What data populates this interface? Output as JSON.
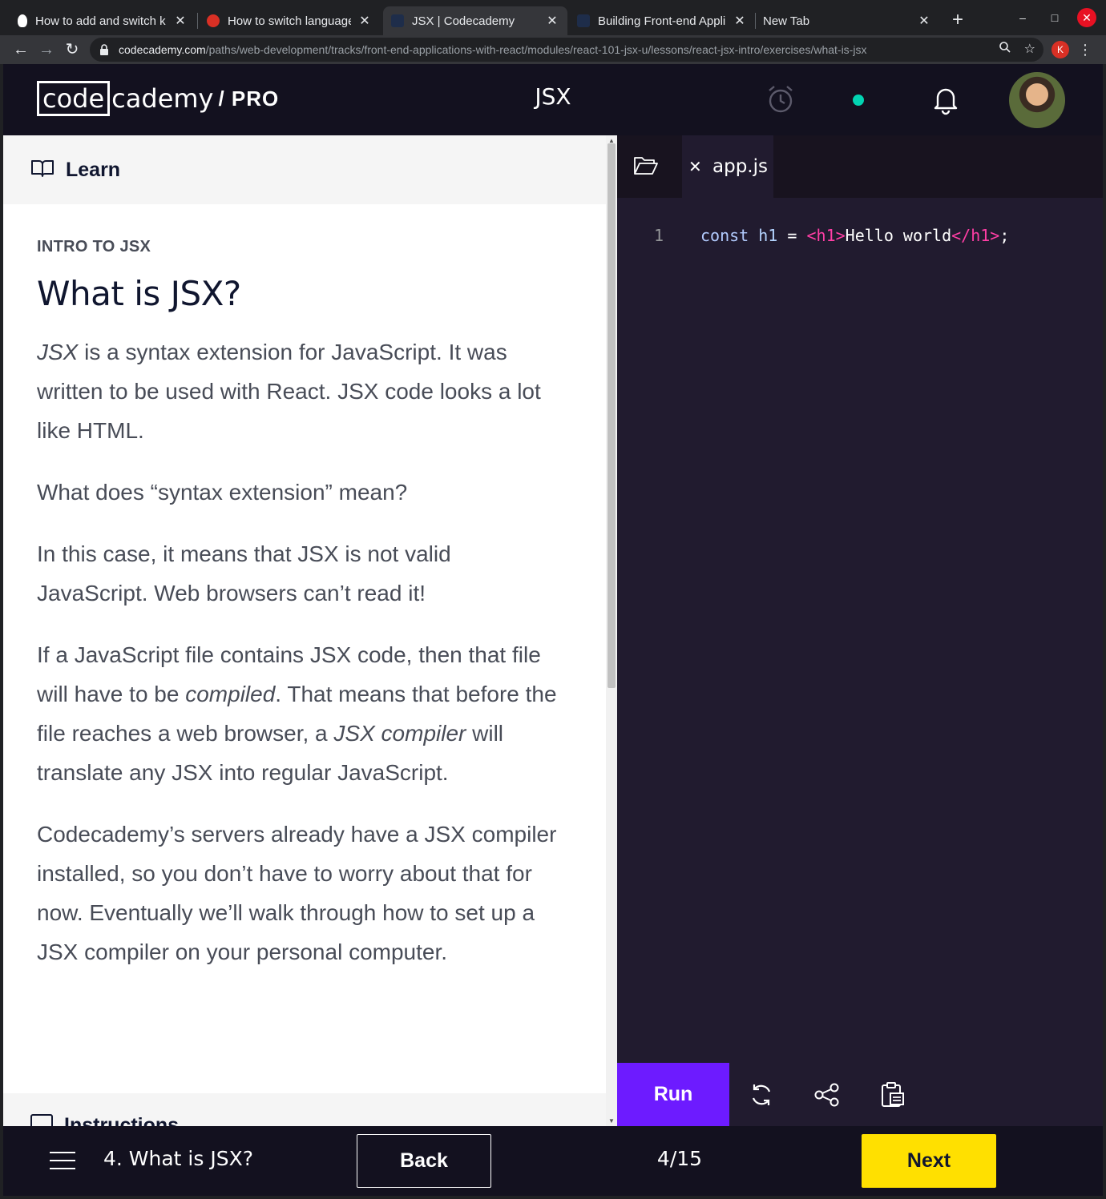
{
  "browser": {
    "tabs": [
      {
        "title": "How to add and switch k",
        "favicon_color": "#ffffff"
      },
      {
        "title": "How to switch language",
        "favicon_color": "#d93025"
      },
      {
        "title": "JSX | Codecademy",
        "favicon_color": "#1e2d4a"
      },
      {
        "title": "Building Front-end Appli",
        "favicon_color": "#1e2d4a"
      },
      {
        "title": "New Tab",
        "favicon_color": ""
      }
    ],
    "url_host": "codecademy.com",
    "url_path": "/paths/web-development/tracks/front-end-applications-with-react/modules/react-101-jsx-u/lessons/react-jsx-intro/exercises/what-is-jsx",
    "profile_initial": "K"
  },
  "header": {
    "logo_box": "code",
    "logo_rest": "cademy",
    "logo_pro": "/ PRO",
    "title": "JSX"
  },
  "learn": {
    "panel_label": "Learn",
    "eyebrow": "INTRO TO JSX",
    "heading": "What is JSX?",
    "p1_em": "JSX",
    "p1_rest": " is a syntax extension for JavaScript. It was written to be used with React. JSX code looks a lot like HTML.",
    "p2": "What does “syntax extension” mean?",
    "p3": "In this case, it means that JSX is not valid JavaScript. Web browsers can’t read it!",
    "p4_a": "If a JavaScript file contains JSX code, then that file will have to be ",
    "p4_em1": "compiled",
    "p4_b": ". That means that before the file reaches a web browser, a ",
    "p4_em2": "JSX compiler",
    "p4_c": " will translate any JSX into regular JavaScript.",
    "p5": "Codecademy’s servers already have a JSX compiler installed, so you don’t have to worry about that for now. Eventually we’ll walk through how to set up a JSX compiler on your personal computer.",
    "instructions_label": "Instructions"
  },
  "editor": {
    "file_name": "app.js",
    "line_number": "1",
    "code": {
      "kw": "const",
      "id": "h1",
      "op": "=",
      "open_tag": "<h1>",
      "text": "Hello world",
      "close_tag": "</h1>",
      "semi": ";"
    },
    "run_label": "Run"
  },
  "footer": {
    "lesson_label": "4. What is JSX?",
    "back_label": "Back",
    "progress": "4/15",
    "next_label": "Next"
  },
  "colors": {
    "header_bg": "#13111f",
    "editor_bg": "#211b2f",
    "run_button": "#6d1bff",
    "next_button": "#ffe000",
    "status_dot": "#02d4b2",
    "jsx_tag": "#ff3ea5"
  }
}
